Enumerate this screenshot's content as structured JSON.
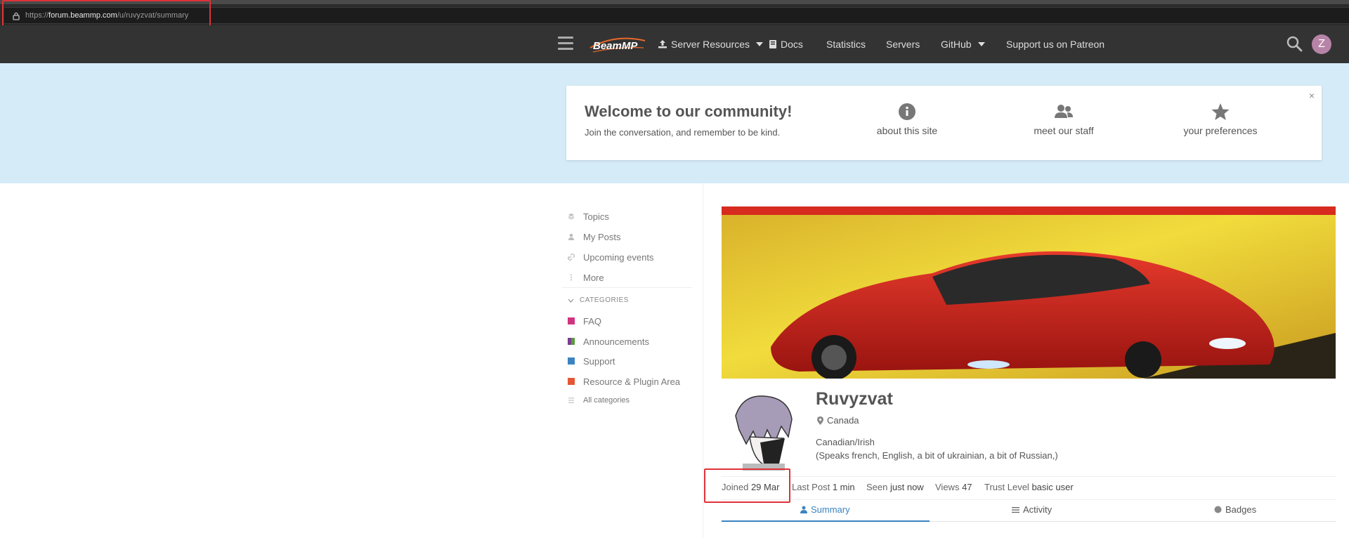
{
  "browser": {
    "url_prefix": "https://",
    "url_host": "forum.beammp.com",
    "url_path": "/u/ruvyzvat/summary"
  },
  "header": {
    "logo_text": "BeamMP",
    "nav": [
      {
        "label": "Server Resources",
        "icon": "upload-icon",
        "has_caret": true
      },
      {
        "label": "Docs",
        "icon": "book-icon",
        "has_caret": false
      },
      {
        "label": "Statistics"
      },
      {
        "label": "Servers"
      },
      {
        "label": "GitHub",
        "has_caret": true
      },
      {
        "label": "Support us on Patreon"
      }
    ],
    "user_initial": "Z"
  },
  "welcome": {
    "title": "Welcome to our community!",
    "subtitle": "Join the conversation, and remember to be kind.",
    "close": "×",
    "items": [
      {
        "label": "about this site",
        "icon": "info-circle-icon"
      },
      {
        "label": "meet our staff",
        "icon": "users-icon"
      },
      {
        "label": "your preferences",
        "icon": "star-icon"
      }
    ]
  },
  "sidebar": {
    "items": [
      {
        "label": "Topics",
        "icon": "layers-icon"
      },
      {
        "label": "My Posts",
        "icon": "user-icon"
      },
      {
        "label": "Upcoming events",
        "icon": "link-icon"
      },
      {
        "label": "More",
        "icon": "vertical-ellipsis-icon"
      }
    ],
    "categories_heading": "CATEGORIES",
    "categories": [
      {
        "label": "FAQ",
        "color": "#d0337f"
      },
      {
        "label": "Announcements",
        "color": "#7a3d8f",
        "color2": "#5b9a3c"
      },
      {
        "label": "Support",
        "color": "#3b83c0"
      },
      {
        "label": "Resource & Plugin Area",
        "color": "#e45735"
      }
    ],
    "all_categories": "All categories"
  },
  "profile": {
    "username": "Ruvyzvat",
    "location": "Canada",
    "bio_line1": "Canadian/Irish",
    "bio_line2": "(Speaks french, English, a bit of ukrainian, a bit of Russian,)",
    "stats": {
      "joined_label": "Joined",
      "joined_value": "29 Mar",
      "last_post_label": "Last Post",
      "last_post_value": "1 min",
      "seen_label": "Seen",
      "seen_value": "just now",
      "views_label": "Views",
      "views_value": "47",
      "trust_label": "Trust Level",
      "trust_value": "basic user"
    },
    "tabs": [
      {
        "label": "Summary",
        "icon": "user-icon",
        "active": true
      },
      {
        "label": "Activity",
        "icon": "list-icon"
      },
      {
        "label": "Badges",
        "icon": "badge-circle-icon"
      }
    ]
  },
  "colors": {
    "header_bg": "#333333",
    "banner_bg": "#d6ebf8",
    "accent": "#3b83c0",
    "highlight_box": "#e0313a"
  }
}
